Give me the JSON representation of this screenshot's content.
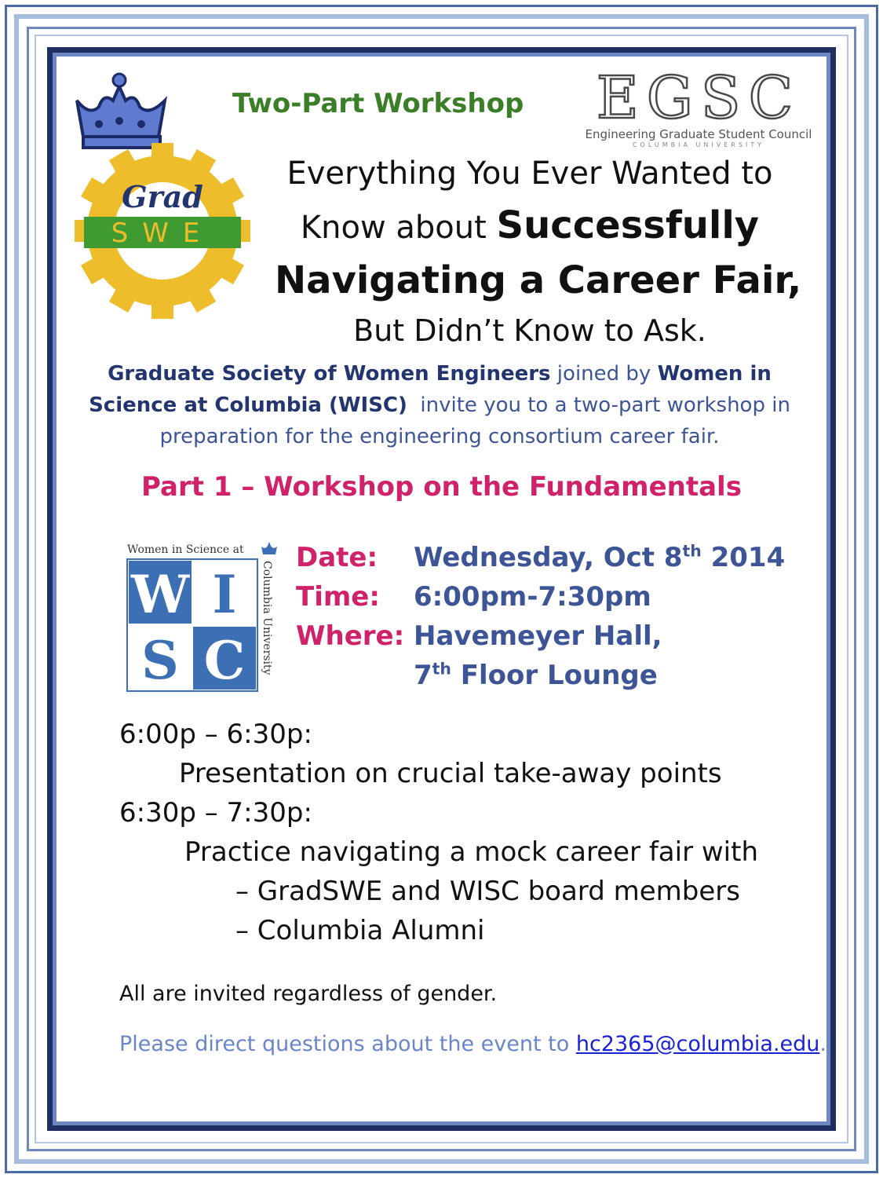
{
  "header": {
    "kicker": "Two-Part Workshop",
    "title_line1": "Everything You Ever Wanted to",
    "title_line2_plain": "Know about ",
    "title_line2_bold": "Successfully",
    "title_line3_bold": "Navigating a Career Fair",
    "title_line3_comma": ",",
    "title_line4": "But Didn’t Know to Ask."
  },
  "logos": {
    "gradswe_script": "Grad",
    "gradswe_block": "SWE",
    "egsc_letters": "EGSC",
    "egsc_name": "Engineering Graduate Student Council",
    "egsc_school": "COLUMBIA UNIVERSITY",
    "wisc_top": "Women in Science at",
    "wisc_side": "Columbia University",
    "wisc_w": "W",
    "wisc_i": "I",
    "wisc_s": "S",
    "wisc_c": "C"
  },
  "intro": {
    "org1": "Graduate Society of Women Engineers",
    "joined": " joined by ",
    "org2": "Women in Science at Columbia (WISC)",
    "rest": "  invite you to a two-part workshop in preparation for the engineering consortium career fair."
  },
  "part1": "Part 1 – Workshop on the Fundamentals",
  "details": {
    "date_label": "Date:",
    "date_value": "Wednesday, Oct 8",
    "date_sup": "th",
    "date_year": " 2014",
    "time_label": "Time:",
    "time_value": "6:00pm-7:30pm",
    "where_label": "Where:",
    "where_value1": "Havemeyer Hall,",
    "where_value2_num": "7",
    "where_value2_sup": "th",
    "where_value2_rest": " Floor Lounge"
  },
  "schedule": {
    "slot1_time": "6:00p – 6:30p:",
    "slot1_desc": "Presentation on crucial take-away points",
    "slot2_time": "6:30p – 7:30p:",
    "slot2_desc": "Practice navigating a mock career fair with",
    "slot2_item1": "– GradSWE and WISC board members",
    "slot2_item2": "– Columbia Alumni"
  },
  "footer": {
    "invite": "All are invited regardless of gender.",
    "contact_prefix": "Please direct questions about the event to ",
    "contact_email": "hc2365@columbia.edu",
    "contact_suffix": "."
  },
  "colors": {
    "green": "#3a7f28",
    "magenta": "#d0226b",
    "navy": "#3d5596",
    "link": "#1a22d6"
  }
}
